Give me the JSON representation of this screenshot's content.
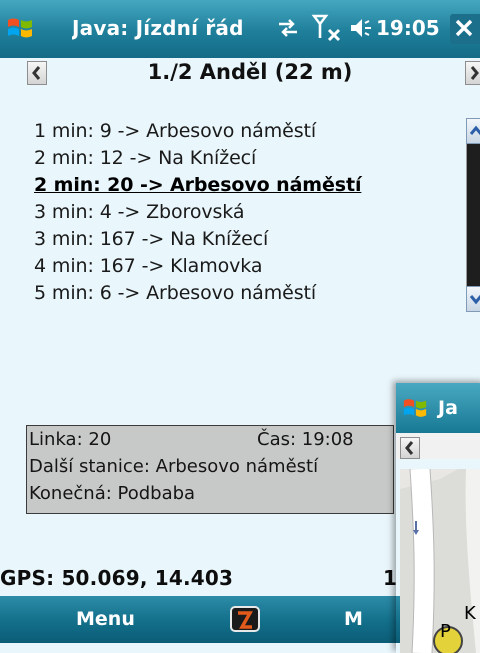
{
  "statusbar": {
    "title": "Java: Jízdní řád",
    "clock": "19:05"
  },
  "header": {
    "stop_title": "1./2 Anděl (22 m)"
  },
  "departures": [
    "1 min: 9 -> Arbesovo náměstí",
    "2 min: 12 -> Na Knížecí",
    "2 min: 20 -> Arbesovo náměstí",
    "3 min: 4 -> Zborovská",
    "3 min: 167 -> Na Knížecí",
    "4 min: 167 -> Klamovka",
    "5 min: 6 -> Arbesovo náměstí"
  ],
  "selected_index": 2,
  "info": {
    "linka": "Linka: 20",
    "cas": "Čas: 19:08",
    "dalsi_stanice": "Další stanice: Arbesovo náměstí",
    "konecna": "Konečná: Podbaba"
  },
  "gps": {
    "text": "GPS: 50.069, 14.403",
    "right_fragment": "1"
  },
  "menubar": {
    "left": "Menu",
    "right": "M"
  },
  "second_window": {
    "title": "Ja",
    "map_label_1": "K",
    "map_label_2": "P"
  },
  "colors": {
    "bar_accent": "#1f7f9b",
    "background": "#e9f6fb",
    "infobox": "#c7c9c8"
  }
}
